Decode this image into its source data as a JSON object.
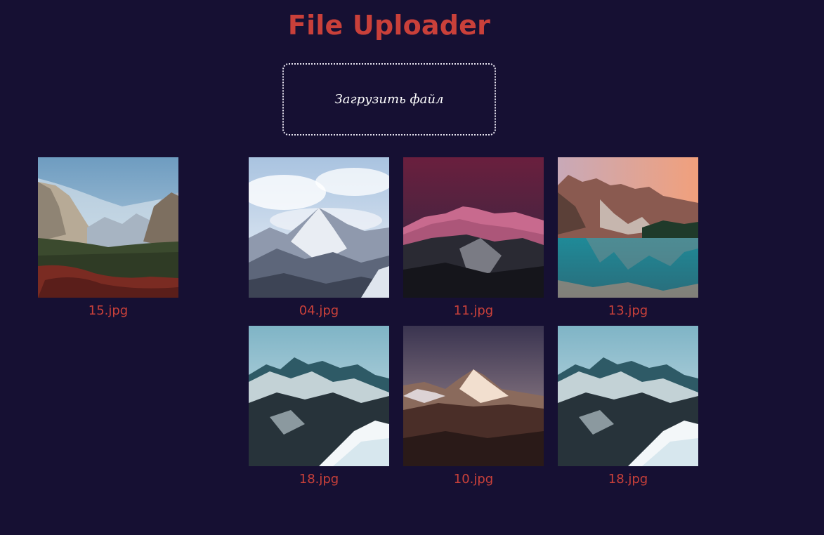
{
  "header": {
    "title": "File Uploader"
  },
  "uploader": {
    "label": "Загрузить файл"
  },
  "files": [
    {
      "name": "15.jpg",
      "scene": "valley-landscape"
    },
    {
      "name": "04.jpg",
      "scene": "snowy-peak-clouds"
    },
    {
      "name": "11.jpg",
      "scene": "pink-sunset-ridge"
    },
    {
      "name": "13.jpg",
      "scene": "turquoise-lake-reflection"
    },
    {
      "name": "18.jpg",
      "scene": "teal-snow-range"
    },
    {
      "name": "10.jpg",
      "scene": "sunlit-summit-dusk"
    },
    {
      "name": "18.jpg",
      "scene": "teal-snow-range"
    }
  ],
  "colors": {
    "background": "#161033",
    "accent": "#c9403a",
    "text_light": "#ffffff"
  }
}
